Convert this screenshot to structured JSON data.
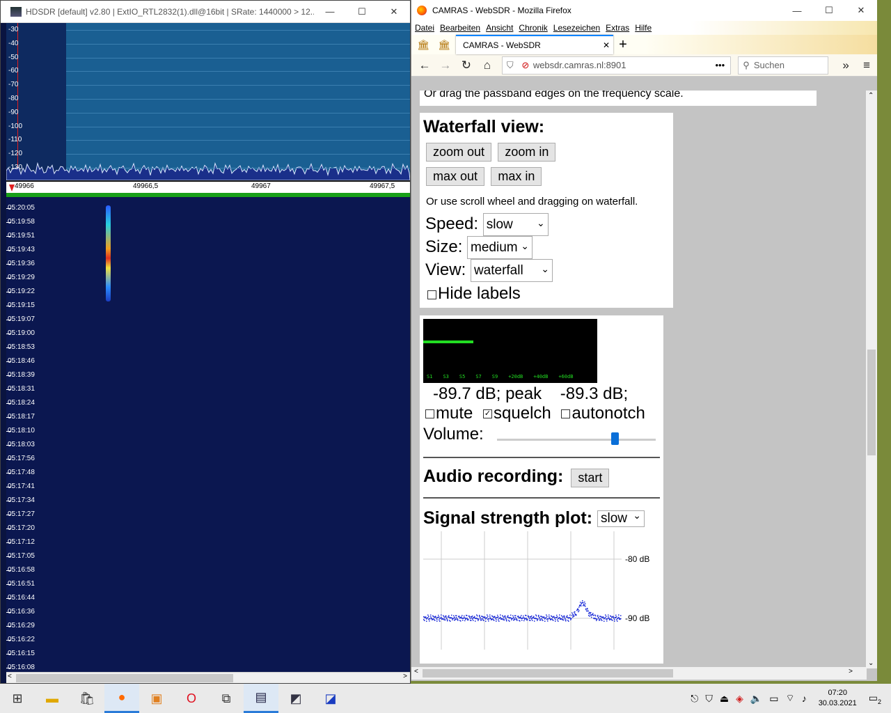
{
  "hdsdr": {
    "title": "HDSDR  [default]  v2.80   |  ExtIO_RTL2832(1).dll@16bit  |  SRate: 1440000 > 12...",
    "db_labels": [
      "-30",
      "-40",
      "-50",
      "-60",
      "-70",
      "-80",
      "-90",
      "-100",
      "-110",
      "-120",
      "-130"
    ],
    "freq_labels": [
      "49966",
      "49966,5",
      "49967",
      "49967,5"
    ],
    "time_labels": [
      "05:20:05",
      "05:19:58",
      "05:19:51",
      "05:19:43",
      "05:19:36",
      "05:19:29",
      "05:19:22",
      "05:19:15",
      "05:19:07",
      "05:19:00",
      "05:18:53",
      "05:18:46",
      "05:18:39",
      "05:18:31",
      "05:18:24",
      "05:18:17",
      "05:18:10",
      "05:18:03",
      "05:17:56",
      "05:17:48",
      "05:17:41",
      "05:17:34",
      "05:17:27",
      "05:17:20",
      "05:17:12",
      "05:17:05",
      "05:16:58",
      "05:16:51",
      "05:16:44",
      "05:16:36",
      "05:16:29",
      "05:16:22",
      "05:16:15",
      "05:16:08"
    ]
  },
  "firefox": {
    "title": "CAMRAS - WebSDR - Mozilla Firefox",
    "menu": [
      "Datei",
      "Bearbeiten",
      "Ansicht",
      "Chronik",
      "Lesezeichen",
      "Extras",
      "Hilfe"
    ],
    "tab_title": "CAMRAS - WebSDR",
    "url": "websdr.camras.nl:8901",
    "search_placeholder": "Suchen",
    "more": "•••"
  },
  "page": {
    "drag_hint": "Or drag the passband edges on the frequency scale.",
    "waterfall_heading": "Waterfall view:",
    "zoom_out": "zoom out",
    "zoom_in": "zoom in",
    "max_out": "max out",
    "max_in": "max in",
    "scroll_hint": "Or use scroll wheel and dragging on waterfall.",
    "speed_label": "Speed:",
    "speed_value": "slow",
    "size_label": "Size:",
    "size_value": "medium",
    "view_label": "View:",
    "view_value": "waterfall",
    "hide_labels": "Hide labels",
    "smeter_labels": [
      "S1",
      "S3",
      "S5",
      "S7",
      "S9",
      "+20dB",
      "+40dB",
      "+60dB"
    ],
    "level_text": "-89.7 dB; peak",
    "peak_text": "-89.3 dB;",
    "mute": "mute",
    "squelch": "squelch",
    "autonotch": "autonotch",
    "volume_label": "Volume:",
    "volume_level": 0.74,
    "audio_heading": "Audio recording:",
    "start": "start",
    "signal_heading": "Signal strength plot:",
    "signal_speed": "slow",
    "plot_label_top": "-80 dB",
    "plot_label_bottom": "-90 dB"
  },
  "taskbar": {
    "time": "07:20",
    "date": "30.03.2021",
    "notifications": "2"
  },
  "colors": {
    "firefox_accent": "#0a84ff",
    "smeter_green": "#22dd22",
    "plot_blue": "#1a2ad8"
  }
}
